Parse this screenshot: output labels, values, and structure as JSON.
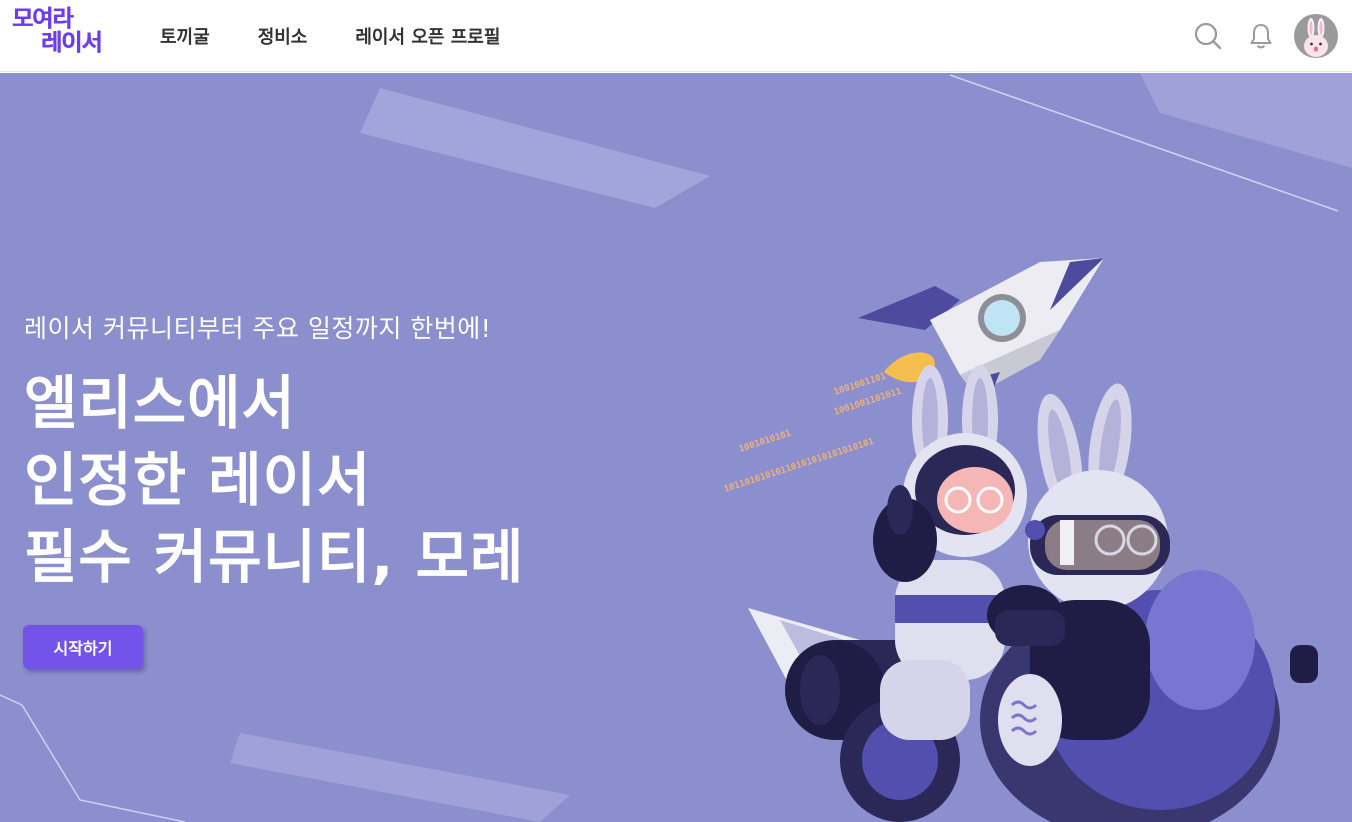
{
  "brand": {
    "logo_line1": "모여라",
    "logo_line2": "레이서",
    "accent_color": "#6c3cf0"
  },
  "nav": {
    "items": [
      {
        "label": "토끼굴"
      },
      {
        "label": "정비소"
      },
      {
        "label": "레이서 오픈 프로필"
      }
    ],
    "icons": [
      "search-icon",
      "bell-icon",
      "avatar"
    ]
  },
  "hero": {
    "subtitle": "레이서 커뮤니티부터 주요 일정까지 한번에!",
    "title_lines": [
      "엘리스에서",
      "인정한 레이서",
      "필수 커뮤니티, 모레"
    ],
    "cta_label": "시작하기",
    "background_color": "#8b8fcd",
    "cta_color": "#7353ea",
    "binary_text": [
      "1001001101",
      "1001001101011",
      "1001010101",
      "10110101010110101010101010101"
    ]
  }
}
